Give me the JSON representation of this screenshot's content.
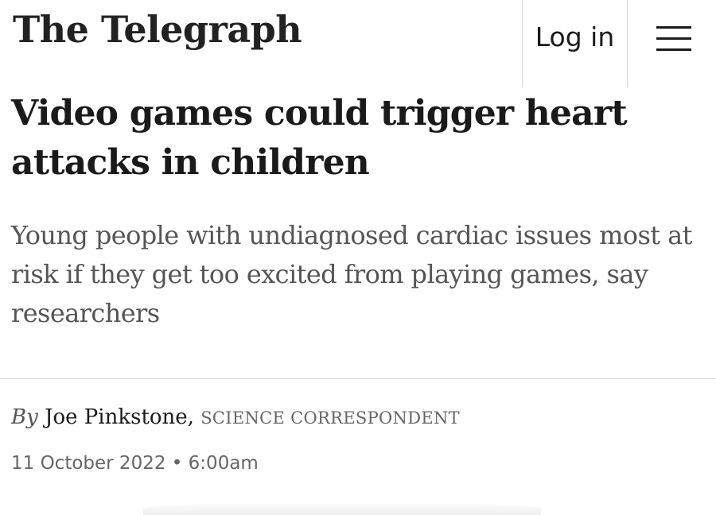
{
  "header": {
    "logo_text": "The Telegraph",
    "login_label": "Log in",
    "menu_icon": "hamburger-menu-icon"
  },
  "article": {
    "headline": "Video games could trigger heart attacks in children",
    "standfirst": "Young people with undiagnosed cardiac issues most at risk if they get too excited from playing games, say researchers",
    "byline": {
      "prefix": "By",
      "author": "Joe Pinkstone,",
      "role": "SCIENCE CORRESPONDENT"
    },
    "date": "11 October 2022",
    "separator": "•",
    "time": "6:00am"
  }
}
